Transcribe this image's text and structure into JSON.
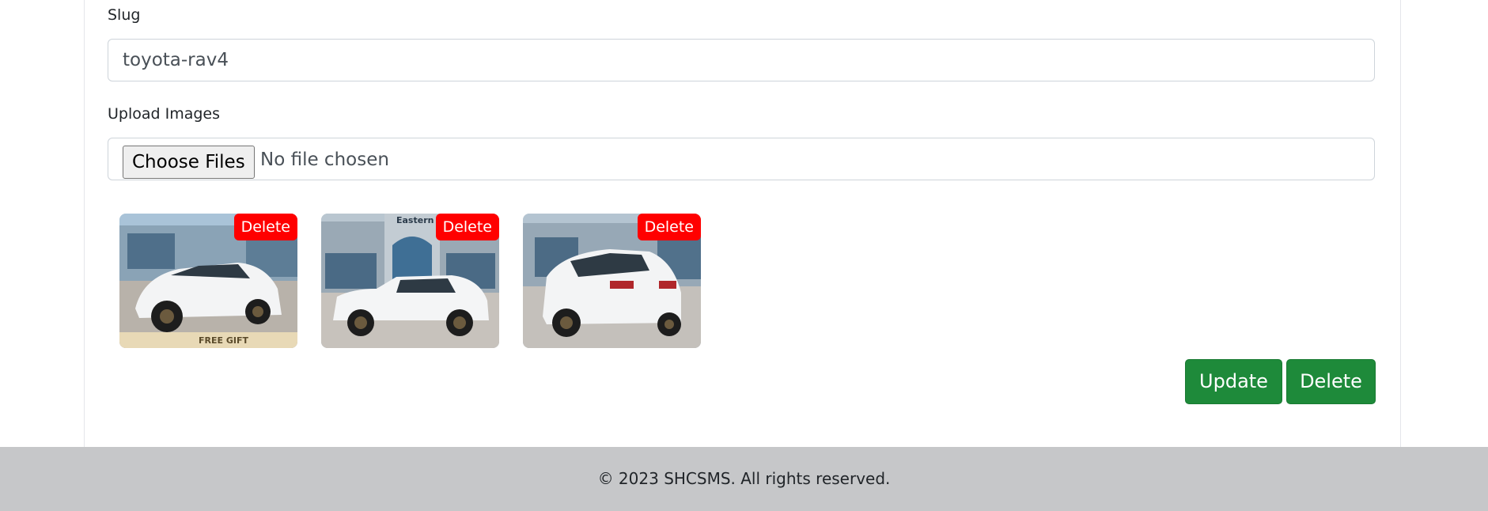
{
  "form": {
    "slug_label": "Slug",
    "slug_value": "toyota-rav4",
    "upload_label": "Upload Images",
    "choose_files_label": "Choose Files",
    "no_file_text": "No file chosen"
  },
  "images": [
    {
      "delete_label": "Delete",
      "banner_text": "FREE GIFT"
    },
    {
      "delete_label": "Delete",
      "sign_text": "Eastern"
    },
    {
      "delete_label": "Delete"
    }
  ],
  "actions": {
    "update_label": "Update",
    "delete_label": "Delete"
  },
  "footer": {
    "text": "© 2023 SHCSMS. All rights reserved."
  },
  "colors": {
    "primary_button": "#1e8a3a",
    "delete_badge": "#ff0000",
    "footer_bg": "#c6c7c9"
  }
}
